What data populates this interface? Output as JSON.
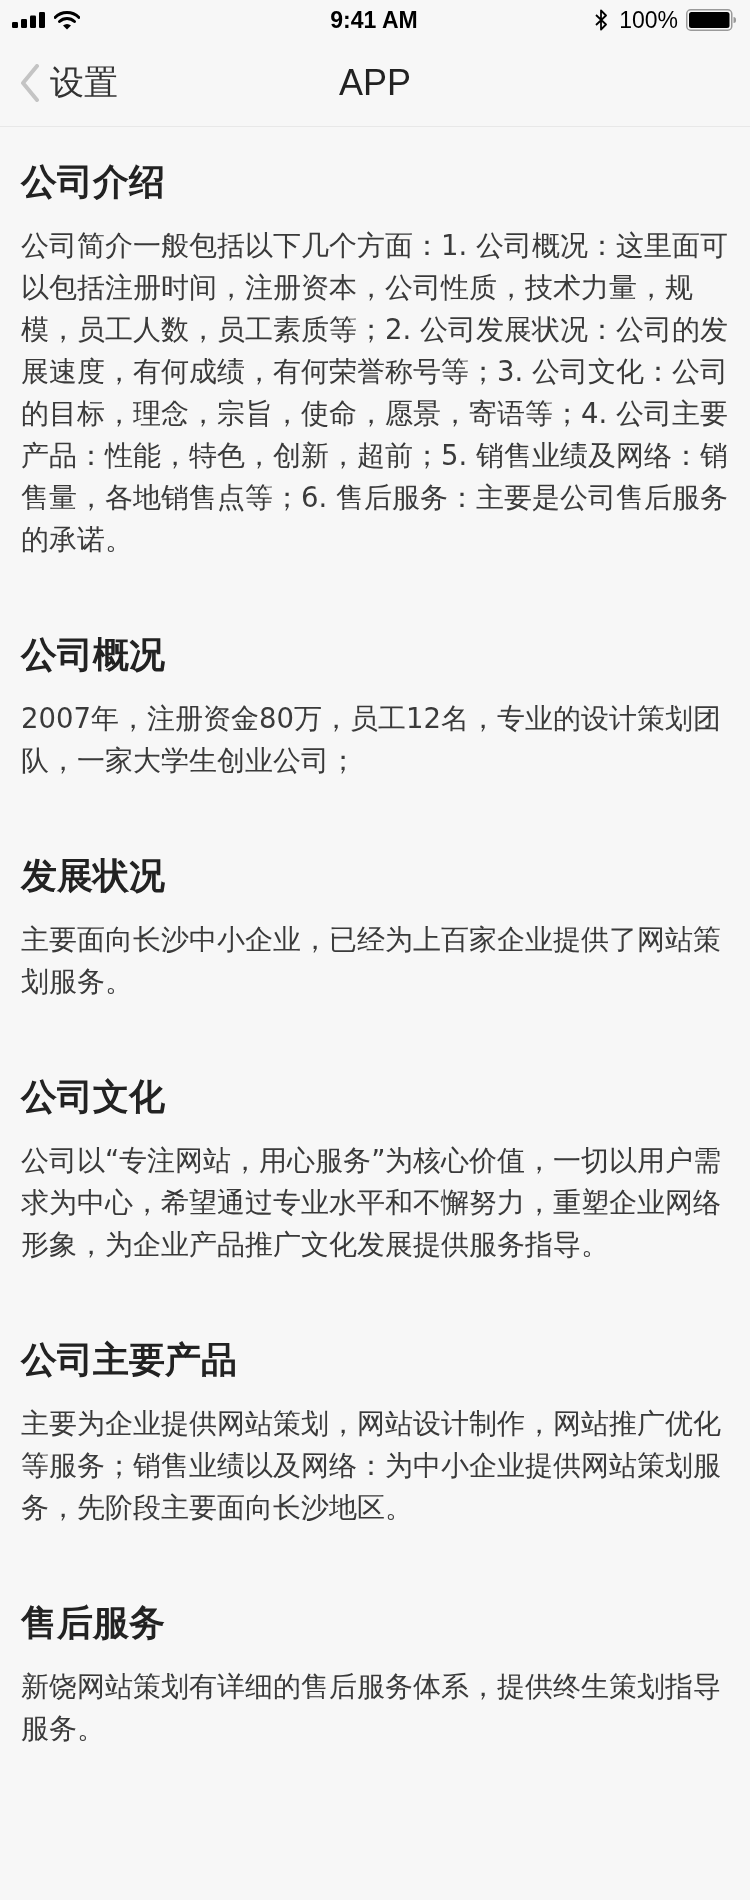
{
  "status_bar": {
    "time": "9:41 AM",
    "battery": "100%"
  },
  "nav_bar": {
    "back_label": "设置",
    "title": "APP"
  },
  "sections": [
    {
      "heading": "公司介绍",
      "body": "公司简介一般包括以下几个方面：1. 公司概况：这里面可以包括注册时间，注册资本，公司性质，技术力量，规模，员工人数，员工素质等；2. 公司发展状况：公司的发展速度，有何成绩，有何荣誉称号等；3. 公司文化：公司的目标，理念，宗旨，使命，愿景，寄语等；4. 公司主要产品：性能，特色，创新，超前；5. 销售业绩及网络：销售量，各地销售点等；6. 售后服务：主要是公司售后服务的承诺。"
    },
    {
      "heading": "公司概况",
      "body": "2007年，注册资金80万，员工12名，专业的设计策划团队，一家大学生创业公司；"
    },
    {
      "heading": "发展状况",
      "body": "主要面向长沙中小企业，已经为上百家企业提供了网站策划服务。"
    },
    {
      "heading": "公司文化",
      "body": "公司以“专注网站，用心服务”为核心价值，一切以用户需求为中心，希望通过专业水平和不懈努力，重塑企业网络形象，为企业产品推广文化发展提供服务指导。"
    },
    {
      "heading": "公司主要产品",
      "body": "主要为企业提供网站策划，网站设计制作，网站推广优化等服务；销售业绩以及网络：为中小企业提供网站策划服务，先阶段主要面向长沙地区。"
    },
    {
      "heading": "售后服务",
      "body": "新饶网站策划有详细的售后服务体系，提供终生策划指导服务。"
    }
  ]
}
